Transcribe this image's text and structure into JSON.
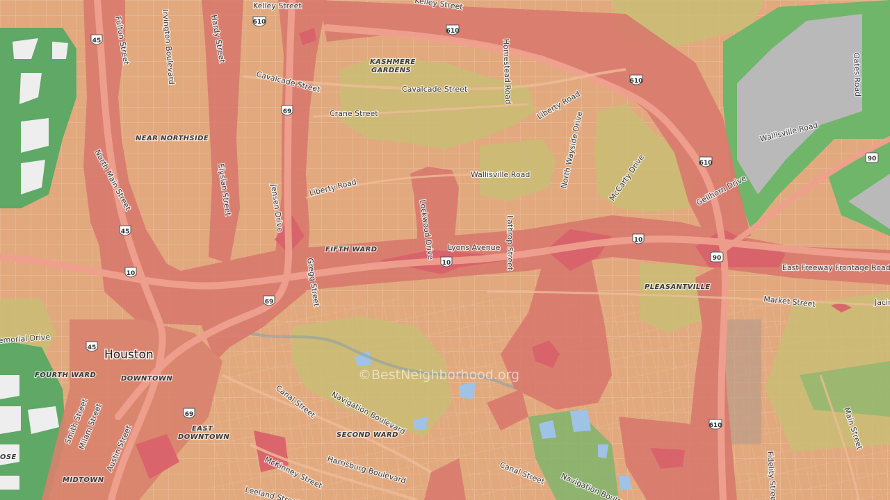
{
  "watermark": "©BestNeighborhood.org",
  "colors": {
    "base_orange": "#e2a97e",
    "red_zone": "#d97a6e",
    "dark_red": "#d9626a",
    "olive_zone": "#c9bd74",
    "green_zone": "#5fa865",
    "industrial_gray": "#b9b9b9",
    "water": "#9fc3e6"
  },
  "labels": {
    "city": "Houston",
    "areas": {
      "near_northside": "NEAR NORTHSIDE",
      "kashmere_1": "KASHMERE",
      "kashmere_2": "GARDENS",
      "fifth_ward": "FIFTH WARD",
      "pleasantville": "PLEASANTVILLE",
      "downtown": "DOWNTOWN",
      "fourth_ward": "FOURTH WARD",
      "east_downtown_1": "EAST",
      "east_downtown_2": "DOWNTOWN",
      "second_ward": "SECOND WARD",
      "midtown": "MIDTOWN",
      "ose": "OSE"
    },
    "streets": {
      "kelley_1": "Kelley Street",
      "kelley_2": "Kelley Street",
      "fulton": "Fulton Street",
      "irvington": "Irvington Boulevard",
      "hardy": "Hardy Street",
      "homestead": "Homestead Road",
      "oates": "Oates Road",
      "cavalcade_1": "Cavalcade Street",
      "cavalcade_2": "Cavalcade Street",
      "crane": "Crane Street",
      "liberty_1": "Liberty Road",
      "liberty_2": "Liberty Road",
      "north_wayside": "North Wayside Drive",
      "wallisville_1": "Wallisville Road",
      "wallisville_2": "Wallisville Road",
      "north_main": "North Main Street",
      "elysian": "Elysian Street",
      "jensen": "Jensen Drive",
      "mccarty": "McCarty Drive",
      "gellhorn": "Gellhorn Drive",
      "lockwood": "Lockwood Drive",
      "lyons": "Lyons Avenue",
      "lathrop": "Lathrop Street",
      "east_freeway": "East Freeway Frontage Road",
      "gregg": "Gregg Street",
      "market": "Market Street",
      "jacinto": "Jacin",
      "memorial": "emorial Drive",
      "canal_1": "Canal Street",
      "canal_2": "Canal Street",
      "navigation_1": "Navigation Boulevard",
      "navigation_2": "Navigation Boulev",
      "smith": "Smith Street",
      "milam": "Milam Street",
      "austin": "Austin Street",
      "mckinney": "McKinney Street",
      "harrisburg": "Harrisburg Boulevard",
      "leeland": "Leeland Street",
      "main": "Main Street",
      "fidelity": "Fidelity Street"
    },
    "shields": {
      "i610_a": "610",
      "i610_b": "610",
      "i610_c": "610",
      "i610_d": "610",
      "i610_e": "610",
      "i45_a": "45",
      "i45_b": "45",
      "i45_c": "45",
      "i69_a": "69",
      "i69_b": "69",
      "i69_c": "69",
      "i10_a": "10",
      "i10_b": "10",
      "i10_c": "10",
      "us90_a": "90",
      "us90_b": "90"
    }
  }
}
